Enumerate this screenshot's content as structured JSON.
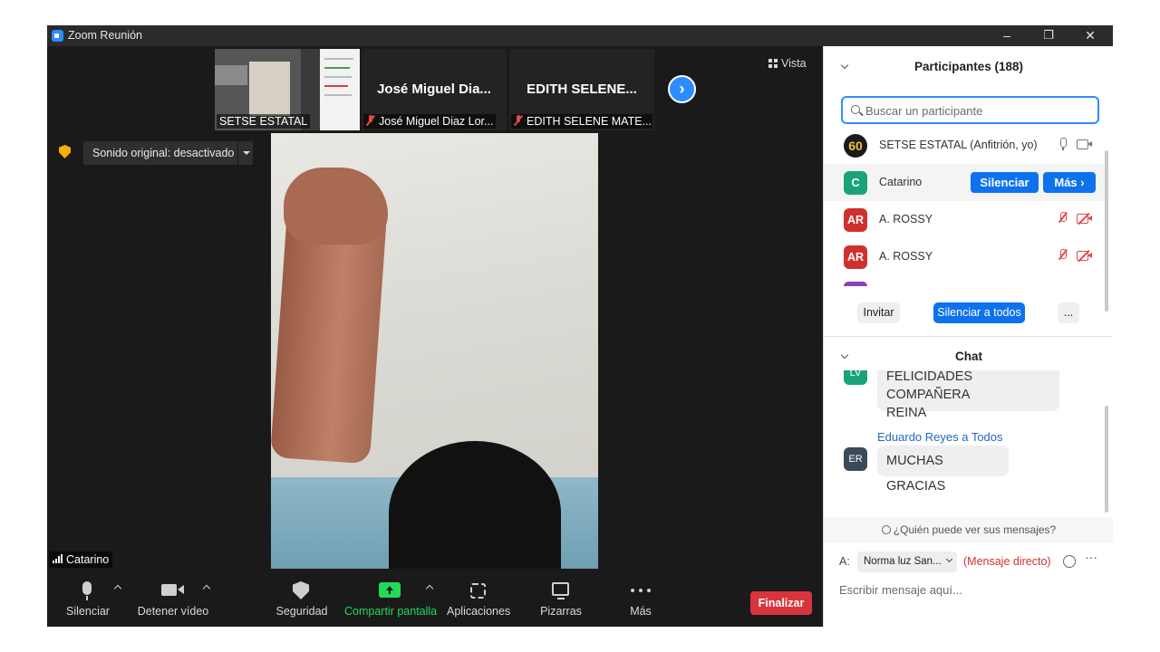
{
  "window": {
    "title": "Zoom Reunión",
    "controls": {
      "minimize": "–",
      "restore": "❐",
      "close": "✕"
    }
  },
  "video": {
    "thumbnails": [
      {
        "name": "",
        "label": "SETSE ESTATAL",
        "muted": false
      },
      {
        "name": "José Miguel Dia...",
        "label": "José Miguel Diaz Lor...",
        "muted": true
      },
      {
        "name": "EDITH SELENE...",
        "label": "EDITH SELENE MATE...",
        "muted": true
      }
    ],
    "next_arrow": "›",
    "view_label": "Vista",
    "sound_label": "Sonido original: desactivado",
    "speaker_name": "Catarino"
  },
  "toolbar": {
    "mute": "Silenciar",
    "stop_video": "Detener vídeo",
    "security": "Seguridad",
    "share_screen": "Compartir pantalla",
    "apps": "Aplicaciones",
    "whiteboards": "Pizarras",
    "more": "Más",
    "end": "Finalizar",
    "accent": "#2d8cff",
    "share_color": "#23d959",
    "end_color": "#d9343c"
  },
  "participants": {
    "title": "Participantes (188)",
    "search_placeholder": "Buscar un participante",
    "list": [
      {
        "avatar": "60",
        "name": "SETSE ESTATAL (Anfitrión, yo)",
        "color": "#1a1a1a"
      },
      {
        "avatar": "C",
        "name": "Catarino",
        "color": "#1aa37a"
      },
      {
        "avatar": "AR",
        "name": "A. ROSSY",
        "color": "#d0312d"
      },
      {
        "avatar": "AR",
        "name": "A. ROSSY",
        "color": "#d0312d"
      }
    ],
    "row_mute_button": "Silenciar",
    "row_more_button": "Más ›",
    "invite": "Invitar",
    "mute_all": "Silenciar a todos",
    "more": "..."
  },
  "chat": {
    "title": "Chat",
    "messages": [
      {
        "avatar": "LV",
        "sender": "",
        "text_line1": "FELICIDADES COMPAÑERA",
        "text_line2": "REINA",
        "color": "#1aa37a"
      },
      {
        "avatar": "ER",
        "sender": "Eduardo Reyes a Todos",
        "text_line1": "MUCHAS GRACIAS",
        "text_line2": "",
        "color": "#3b4a5a"
      }
    ],
    "who_sees": "¿Quién puede ver sus mensajes?",
    "to_label": "A:",
    "to_value": "Norma luz San...",
    "direct": "(Mensaje directo)",
    "input_placeholder": "Escribir mensaje aquí..."
  }
}
